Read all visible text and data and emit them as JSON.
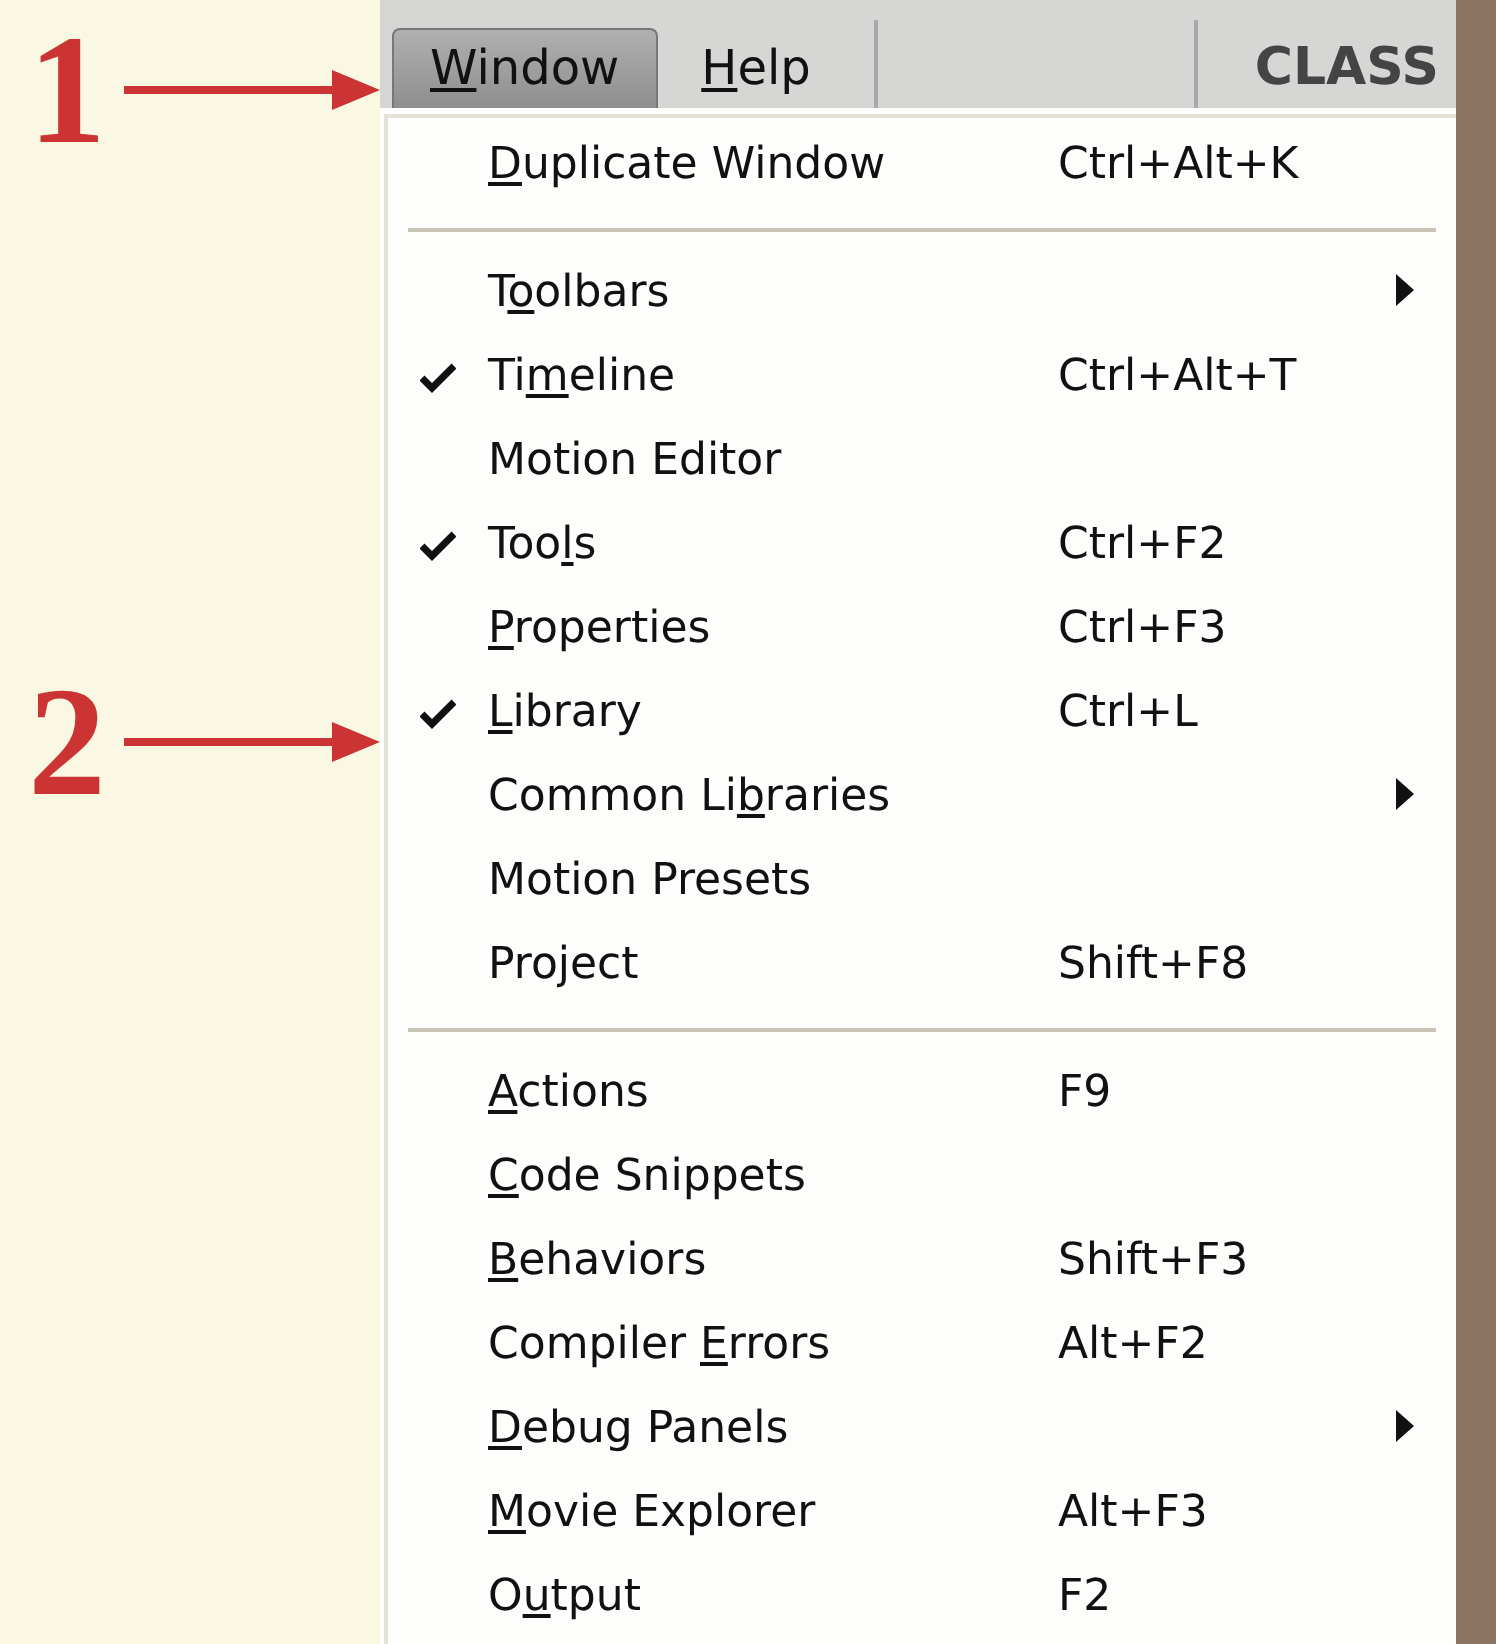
{
  "annotations": [
    {
      "label": "1"
    },
    {
      "label": "2"
    }
  ],
  "menu_bar": {
    "items": [
      {
        "label": {
          "key": "W",
          "post": "indow"
        },
        "selected": true
      },
      {
        "label": {
          "key": "H",
          "post": "elp"
        },
        "selected": false
      }
    ],
    "panel_title": "CLASS"
  },
  "menu": {
    "items": [
      {
        "kind": "item",
        "label": {
          "key": "D",
          "post": "uplicate Window"
        },
        "shortcut": "Ctrl+Alt+K",
        "checked": false,
        "submenu": false
      },
      {
        "kind": "separator"
      },
      {
        "kind": "item",
        "label": {
          "pre": "T",
          "key": "o",
          "post": "olbars"
        },
        "checked": false,
        "submenu": true
      },
      {
        "kind": "item",
        "label": {
          "pre": "Ti",
          "key": "m",
          "post": "eline"
        },
        "shortcut": "Ctrl+Alt+T",
        "checked": true,
        "submenu": false
      },
      {
        "kind": "item",
        "label": {
          "pre": "Motion Editor"
        },
        "checked": false,
        "submenu": false
      },
      {
        "kind": "item",
        "label": {
          "pre": "Too",
          "key": "l",
          "post": "s"
        },
        "shortcut": "Ctrl+F2",
        "checked": true,
        "submenu": false
      },
      {
        "kind": "item",
        "label": {
          "key": "P",
          "post": "roperties"
        },
        "shortcut": "Ctrl+F3",
        "checked": false,
        "submenu": false
      },
      {
        "kind": "item",
        "label": {
          "key": "L",
          "post": "ibrary"
        },
        "shortcut": "Ctrl+L",
        "checked": true,
        "submenu": false
      },
      {
        "kind": "item",
        "label": {
          "pre": "Common Li",
          "key": "b",
          "post": "raries"
        },
        "checked": false,
        "submenu": true
      },
      {
        "kind": "item",
        "label": {
          "pre": "Motion Presets"
        },
        "checked": false,
        "submenu": false
      },
      {
        "kind": "item",
        "label": {
          "pre": "Project"
        },
        "shortcut": "Shift+F8",
        "checked": false,
        "submenu": false
      },
      {
        "kind": "separator"
      },
      {
        "kind": "item",
        "label": {
          "key": "A",
          "post": "ctions"
        },
        "shortcut": "F9",
        "checked": false,
        "submenu": false
      },
      {
        "kind": "item",
        "label": {
          "key": "C",
          "post": "ode Snippets"
        },
        "checked": false,
        "submenu": false
      },
      {
        "kind": "item",
        "label": {
          "key": "B",
          "post": "ehaviors"
        },
        "shortcut": "Shift+F3",
        "checked": false,
        "submenu": false
      },
      {
        "kind": "item",
        "label": {
          "pre": "Compiler ",
          "key": "E",
          "post": "rrors"
        },
        "shortcut": "Alt+F2",
        "checked": false,
        "submenu": false
      },
      {
        "kind": "item",
        "label": {
          "key": "D",
          "post": "ebug Panels"
        },
        "checked": false,
        "submenu": true
      },
      {
        "kind": "item",
        "label": {
          "key": "M",
          "post": "ovie Explorer"
        },
        "shortcut": "Alt+F3",
        "checked": false,
        "submenu": false
      },
      {
        "kind": "item",
        "label": {
          "pre": "O",
          "key": "u",
          "post": "tput"
        },
        "shortcut": "F2",
        "checked": false,
        "submenu": false
      }
    ]
  }
}
